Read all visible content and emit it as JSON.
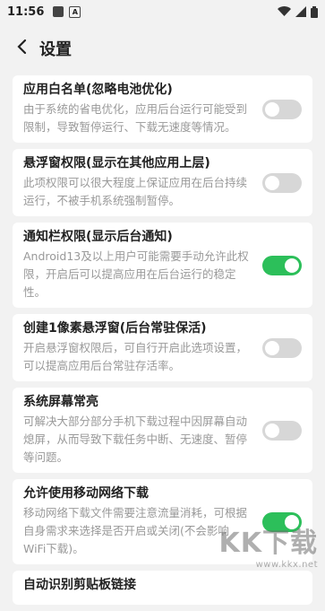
{
  "status_bar": {
    "time": "11:56",
    "icons": [
      "square-icon",
      "a-icon",
      "wifi-icon",
      "signal-icon",
      "battery-icon"
    ]
  },
  "header": {
    "title": "设置",
    "back_icon": "chevron-left-icon"
  },
  "settings": [
    {
      "title": "应用白名单(忽略电池优化)",
      "desc": "由于系统的省电优化，应用后台运行可能受到限制，导致暂停运行、下载无速度等情况。",
      "enabled": false
    },
    {
      "title": "悬浮窗权限(显示在其他应用上层)",
      "desc": "此项权限可以很大程度上保证应用在后台持续运行，不被手机系统强制暂停。",
      "enabled": false
    },
    {
      "title": "通知栏权限(显示后台通知)",
      "desc": "Android13及以上用户可能需要手动允许此权限，开启后可以提高应用在后台运行的稳定性。",
      "enabled": true
    },
    {
      "title": "创建1像素悬浮窗(后台常驻保活)",
      "desc": "开启悬浮窗权限后，可自行开启此选项设置，可以提高应用后台常驻存活率。",
      "enabled": false
    },
    {
      "title": "系统屏幕常亮",
      "desc": "可解决大部分部分手机下载过程中因屏幕自动熄屏，从而导致下载任务中断、无速度、暂停等问题。",
      "enabled": false
    },
    {
      "title": "允许使用移动网络下载",
      "desc": "移动网络下载文件需要注意流量消耗，可根据自身需求来选择是否开启或关闭(不会影响WiFi下载)。",
      "enabled": true
    },
    {
      "title": "自动识别剪贴板链接",
      "desc": "",
      "enabled": false
    }
  ],
  "watermark": {
    "logo": "KK下载",
    "url": "www.kkx.net"
  }
}
